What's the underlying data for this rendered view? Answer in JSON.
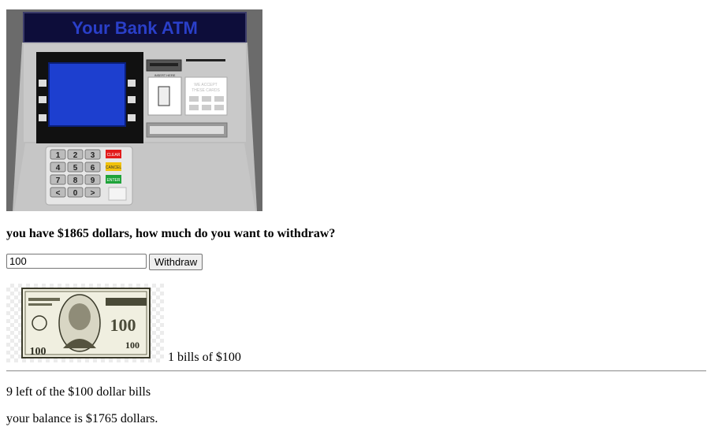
{
  "atm": {
    "sign_text": "Your Bank ATM",
    "insert_label": "INSERT HERE",
    "cards_label_1": "WE ACCEPT",
    "cards_label_2": "THESE CARDS",
    "keys": [
      "1",
      "2",
      "3",
      "4",
      "5",
      "6",
      "7",
      "8",
      "9",
      "<",
      "0",
      ">"
    ],
    "clear_label": "CLEAR",
    "cancel_label": "CANCEL",
    "enter_label": "ENTER",
    "colors": {
      "body": "#c8c8c8",
      "frame": "#6b6b6b",
      "sign_bg": "#0d0d3a",
      "sign_text": "#2a3fc9",
      "screen": "#1d3fcf",
      "clear": "#e21a1a",
      "cancel": "#f2c20b",
      "enter": "#1fa33a"
    }
  },
  "prompt": {
    "text": "you have $1865 dollars, how much do you want to withdraw?"
  },
  "withdraw_form": {
    "amount_value": "100",
    "button_label": "Withdraw"
  },
  "result": {
    "bill_count_text": "1 bills of $100",
    "bill_denomination": "100",
    "remaining_text": "9 left of the $100 dollar bills",
    "balance_text": "your balance is $1765 dollars."
  }
}
